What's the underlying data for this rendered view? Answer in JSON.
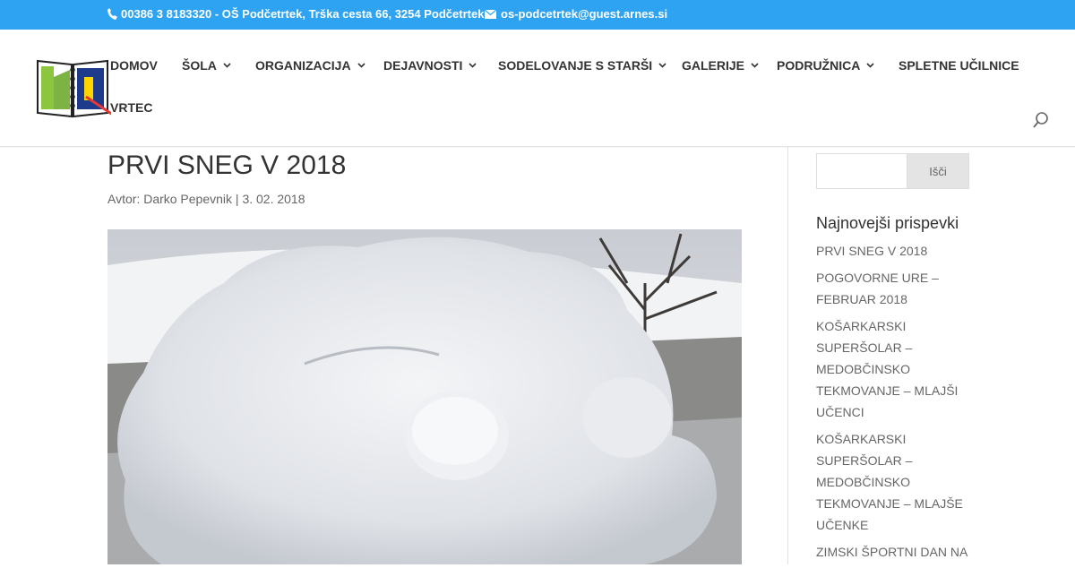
{
  "topbar": {
    "phone": "00386 3 8183320 - OŠ Podčetrtek, Trška cesta 66, 3254 Podčetrtek",
    "email": "os-podcetrtek@guest.arnes.si"
  },
  "nav": {
    "items": [
      {
        "label": "DOMOV"
      },
      {
        "label": "ŠOLA"
      },
      {
        "label": "ORGANIZACIJA"
      },
      {
        "label": "DEJAVNOSTI"
      },
      {
        "label": "SODELOVANJE S STARŠI"
      },
      {
        "label": "GALERIJE"
      },
      {
        "label": "PODRUŽNICA"
      },
      {
        "label": "SPLETNE UČILNICE"
      },
      {
        "label": "VRTEC"
      }
    ]
  },
  "post": {
    "title": "PRVI SNEG V 2018",
    "meta": "Avtor: Darko Pepevnik | 3. 02. 2018"
  },
  "sidebar": {
    "search_button": "Išči",
    "search_placeholder": "",
    "recent_title": "Najnovejši prispevki",
    "recent": [
      "PRVI SNEG V 2018",
      "POGOVORNE URE – FEBRUAR 2018",
      "KOŠARKARSKI SUPERŠOLAR – MEDOBČINSKO TEKMOVANJE – MLAJŠI UČENCI",
      "KOŠARKARSKI SUPERŠOLAR – MEDOBČINSKO TEKMOVANJE – MLAJŠE UČENKE",
      "ZIMSKI ŠPORTNI DAN NA"
    ]
  },
  "colors": {
    "accent": "#2ea3f2",
    "nav_text": "#333333"
  }
}
